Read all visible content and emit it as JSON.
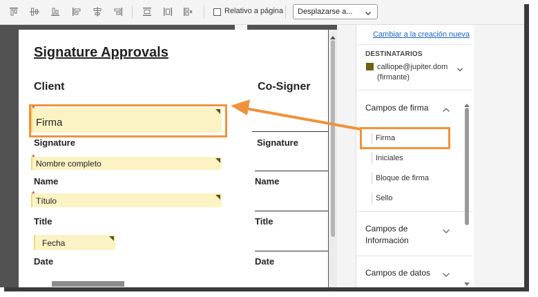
{
  "toolbar": {
    "icons": [
      "align-top-icon",
      "align-middle-vertical-icon",
      "align-bottom-icon",
      "align-left-icon",
      "align-center-horizontal-icon",
      "align-right-icon",
      "distribute-horizontal-icon",
      "distribute-vertical-icon",
      "match-size-icon"
    ],
    "checkbox_label": "Relativo a página",
    "checkbox_checked": false,
    "select_value": "Desplazarse a..."
  },
  "document": {
    "title": "Signature Approvals",
    "columns": [
      "Client",
      "Co-Signer"
    ],
    "client_fields": [
      {
        "value": "Firma",
        "required": true,
        "label": "Signature"
      },
      {
        "value": "Nombre completo",
        "required": true,
        "label": "Name"
      },
      {
        "value": "Título",
        "required": true,
        "label": "Title"
      },
      {
        "value": "Fecha",
        "required": false,
        "label": "Date"
      }
    ],
    "cosigner_labels": [
      "Signature",
      "Name",
      "Title",
      "Date"
    ],
    "required_marker": "*"
  },
  "panel": {
    "switch_link": "Cambiar a la creación nueva",
    "recipients_header": "DESTINATARIOS",
    "recipient_email": "calliope@jupiter.dom",
    "recipient_role": "(firmante)",
    "recipient_color": "#6b6310",
    "signature_fields_header": "Campos de firma",
    "signature_fields": [
      "Firma",
      "Iniciales",
      "Bloque de firma",
      "Sello"
    ],
    "info_fields_header": [
      "Campos de",
      "Información"
    ],
    "data_fields_header": "Campos de datos"
  },
  "colors": {
    "accent_orange": "#f0923b",
    "field_fill": "#fcf3c4",
    "link_blue": "#1b63c6"
  }
}
